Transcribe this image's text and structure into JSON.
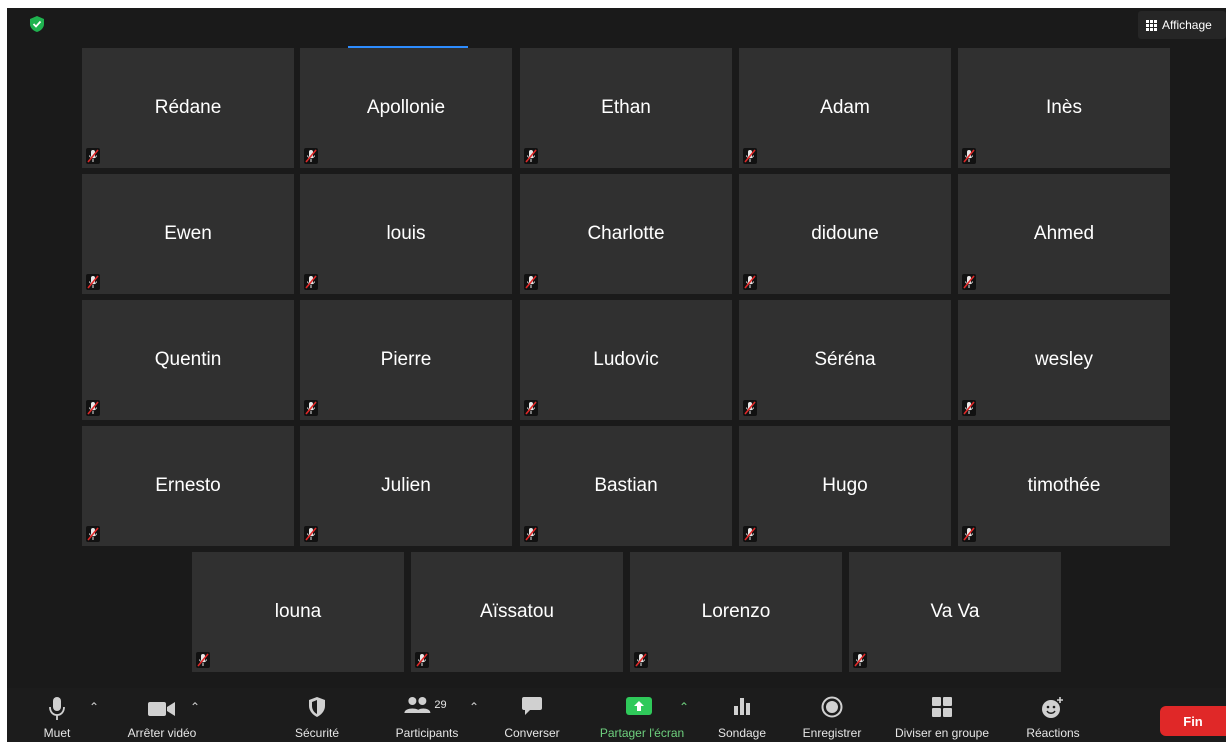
{
  "header": {
    "view_label": "Affichage",
    "security_status": "shield-check-icon"
  },
  "participants": [
    "Rédane",
    "Apollonie",
    "Ethan",
    "Adam",
    "Inès",
    "Ewen",
    "louis",
    "Charlotte",
    "didoune",
    "Ahmed",
    "Quentin",
    "Pierre",
    "Ludovic",
    "Séréna",
    "wesley",
    "Ernesto",
    "Julien",
    "Bastian",
    "Hugo",
    "timothée",
    "louna",
    "Aïssatou",
    "Lorenzo",
    "Va Va"
  ],
  "toolbar": {
    "mute_label": "Muet",
    "video_label": "Arrêter vidéo",
    "security_label": "Sécurité",
    "participants_label": "Participants",
    "participants_count": "29",
    "chat_label": "Converser",
    "share_label": "Partager l'écran",
    "poll_label": "Sondage",
    "record_label": "Enregistrer",
    "breakout_label": "Diviser en groupe",
    "reactions_label": "Réactions",
    "end_label": "Fin"
  },
  "colors": {
    "background": "#1a1a1a",
    "tile": "#303030",
    "share_green": "#6ed07e",
    "end_red": "#e02828",
    "mute_red": "#e02828"
  }
}
